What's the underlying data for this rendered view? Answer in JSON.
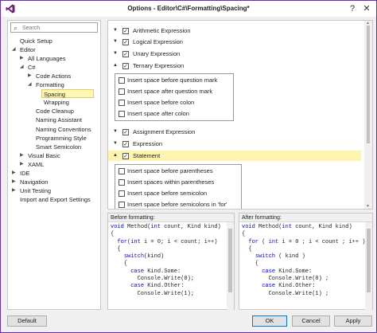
{
  "window": {
    "title": "Options - Editor\\C#\\Formatting\\Spacing*",
    "help": "?",
    "close": "✕"
  },
  "search": {
    "placeholder": "Search"
  },
  "tree": [
    {
      "label": "Quick Setup",
      "indent": 0,
      "arrow": ""
    },
    {
      "label": "Editor",
      "indent": 0,
      "arrow": "◢"
    },
    {
      "label": "All Languages",
      "indent": 1,
      "arrow": "▶"
    },
    {
      "label": "C#",
      "indent": 1,
      "arrow": "◢"
    },
    {
      "label": "Code Actions",
      "indent": 2,
      "arrow": "▶"
    },
    {
      "label": "Formatting",
      "indent": 2,
      "arrow": "◢"
    },
    {
      "label": "Spacing",
      "indent": 3,
      "arrow": "",
      "selected": true
    },
    {
      "label": "Wrapping",
      "indent": 3,
      "arrow": ""
    },
    {
      "label": "Code Cleanup",
      "indent": 2,
      "arrow": ""
    },
    {
      "label": "Naming Assistant",
      "indent": 2,
      "arrow": ""
    },
    {
      "label": "Naming Conventions",
      "indent": 2,
      "arrow": ""
    },
    {
      "label": "Programming Style",
      "indent": 2,
      "arrow": ""
    },
    {
      "label": "Smart Semicolon",
      "indent": 2,
      "arrow": ""
    },
    {
      "label": "Visual Basic",
      "indent": 1,
      "arrow": "▶"
    },
    {
      "label": "XAML",
      "indent": 1,
      "arrow": "▶"
    },
    {
      "label": "IDE",
      "indent": 0,
      "arrow": "▶"
    },
    {
      "label": "Navigation",
      "indent": 0,
      "arrow": "▶"
    },
    {
      "label": "Unit Testing",
      "indent": 0,
      "arrow": "▶"
    },
    {
      "label": "Import and Export Settings",
      "indent": 0,
      "arrow": ""
    }
  ],
  "options": {
    "arithmetic": "Arithmetic Expression",
    "logical": "Logical Expression",
    "unary": "Unary Expression",
    "ternary": "Ternary Expression",
    "ternary_sub": [
      "Insert space before question mark",
      "Insert space after question mark",
      "Insert space before colon",
      "Insert space after colon"
    ],
    "assignment": "Assignment Expression",
    "expression": "Expression",
    "statement": "Statement",
    "statement_sub": [
      "Insert space before parentheses",
      "Insert spaces within parentheses",
      "Insert space before semicolon",
      "Insert space before semicolons in 'for' loops"
    ],
    "check": "✓",
    "caret_open": "▼",
    "caret_collapsed": "▲"
  },
  "preview": {
    "before_label": "Before formatting:",
    "after_label": "After formatting:",
    "before_code": [
      "void Method(int count, Kind kind)",
      "{",
      "  for(int i = 0; i < count; i++)",
      "  {",
      "    switch(kind)",
      "    {",
      "      case Kind.Some:",
      "        Console.Write(0);",
      "      case Kind.Other:",
      "        Console.Write(1);"
    ],
    "after_code": [
      "void Method(int count, Kind kind)",
      "{",
      "  for ( int i = 0 ; i < count ; i++ )",
      "  {",
      "    switch ( kind )",
      "    {",
      "      case Kind.Some:",
      "        Console.Write(0) ;",
      "      case Kind.Other:",
      "        Console.Write(1) ;"
    ]
  },
  "buttons": {
    "default": "Default",
    "ok": "OK",
    "cancel": "Cancel",
    "apply": "Apply"
  },
  "colors": {
    "accent": "#6b2fbf",
    "selection": "#fff8b5",
    "keyword": "#0000ff"
  }
}
